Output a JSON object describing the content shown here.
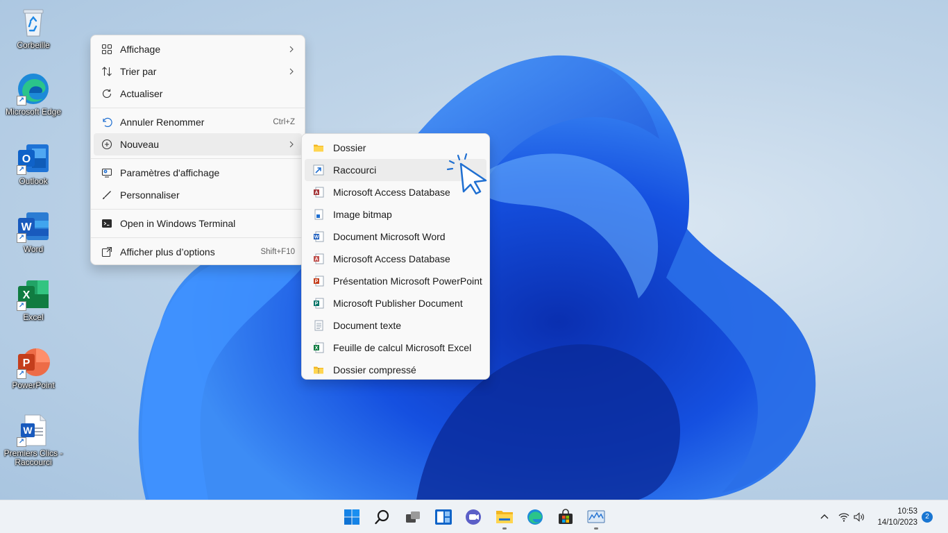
{
  "desktop": {
    "icons": [
      {
        "label": "Corbeille",
        "icon": "recycle-bin-icon"
      },
      {
        "label": "Microsoft Edge",
        "icon": "edge-icon"
      },
      {
        "label": "Outlook",
        "icon": "outlook-icon"
      },
      {
        "label": "Word",
        "icon": "word-icon"
      },
      {
        "label": "Excel",
        "icon": "excel-icon"
      },
      {
        "label": "PowerPoint",
        "icon": "powerpoint-icon"
      },
      {
        "label": "Premiers Clics - Raccourci",
        "icon": "word-document-icon"
      }
    ]
  },
  "context_menu": {
    "items": [
      {
        "label": "Affichage",
        "icon": "grid-view-icon",
        "submenu": true
      },
      {
        "label": "Trier par",
        "icon": "sort-icon",
        "submenu": true
      },
      {
        "label": "Actualiser",
        "icon": "refresh-icon"
      },
      {
        "label": "Annuler Renommer",
        "icon": "undo-icon",
        "shortcut": "Ctrl+Z"
      },
      {
        "label": "Nouveau",
        "icon": "new-plus-icon",
        "submenu": true,
        "active": true
      },
      {
        "label": "Paramètres d'affichage",
        "icon": "display-settings-icon"
      },
      {
        "label": "Personnaliser",
        "icon": "brush-icon"
      },
      {
        "label": "Open in Windows Terminal",
        "icon": "terminal-icon"
      },
      {
        "label": "Afficher plus d’options",
        "icon": "more-options-icon",
        "shortcut": "Shift+F10"
      }
    ]
  },
  "submenu_nouveau": {
    "items": [
      {
        "label": "Dossier",
        "icon": "folder-icon"
      },
      {
        "label": "Raccourci",
        "icon": "shortcut-icon",
        "hovered": true
      },
      {
        "label": "Microsoft Access Database",
        "icon": "access-icon"
      },
      {
        "label": "Image bitmap",
        "icon": "bitmap-icon"
      },
      {
        "label": "Document Microsoft Word",
        "icon": "word-doc-icon"
      },
      {
        "label": "Microsoft Access Database",
        "icon": "access-icon"
      },
      {
        "label": "Présentation Microsoft PowerPoint",
        "icon": "powerpoint-doc-icon"
      },
      {
        "label": "Microsoft Publisher Document",
        "icon": "publisher-doc-icon"
      },
      {
        "label": "Document texte",
        "icon": "text-doc-icon"
      },
      {
        "label": "Feuille de calcul Microsoft Excel",
        "icon": "excel-doc-icon"
      },
      {
        "label": "Dossier compressé",
        "icon": "zip-folder-icon"
      }
    ]
  },
  "taskbar": {
    "apps": [
      "start-icon",
      "search-icon",
      "task-view-icon",
      "widgets-icon",
      "chat-icon",
      "file-explorer-icon",
      "edge-icon",
      "store-icon",
      "performance-monitor-icon"
    ],
    "clock_time": "10:53",
    "clock_date": "14/10/2023",
    "notification_count": "2"
  },
  "colors": {
    "accent": "#1f6fd1",
    "menu_bg": "#f9f9f9",
    "taskbar_bg": "#eef2f6"
  }
}
